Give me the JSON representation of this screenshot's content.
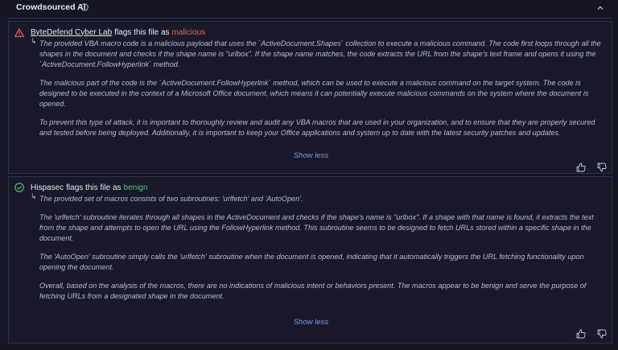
{
  "header": {
    "title": "Crowdsourced AI",
    "info_icon": "info-icon",
    "collapse_icon": "chevron-up-icon"
  },
  "colors": {
    "malicious": "#f2645e",
    "benign": "#57c27a",
    "link": "#7b9cf0",
    "background": "#151524"
  },
  "results": [
    {
      "status_icon": "warning-triangle-icon",
      "vendor": "ByteDefend Cyber Lab",
      "flag_text": "flags this file as",
      "verdict": "malicious",
      "paragraphs": [
        "The provided VBA macro code is a malicious payload that uses the `ActiveDocument.Shapes` collection to execute a malicious command. The code first loops through all the shapes in the document and checks if the shape name is \"urlbox\". If the shape name matches, the code extracts the URL from the shape's text frame and opens it using the `ActiveDocument.FollowHyperlink` method.",
        "The malicious part of the code is the `ActiveDocument.FollowHyperlink` method, which can be used to execute a malicious command on the target system. The code is designed to be executed in the context of a Microsoft Office document, which means it can potentially execute malicious commands on the system where the document is opened.",
        "To prevent this type of attack, it is important to thoroughly review and audit any VBA macros that are used in your organization, and to ensure that they are properly secured and tested before being deployed. Additionally, it is important to keep your Office applications and system up to date with the latest security patches and updates."
      ],
      "show_less": "Show less"
    },
    {
      "status_icon": "check-circle-icon",
      "vendor": "Hispasec",
      "flag_text": "flags this file as",
      "verdict": "benign",
      "paragraphs": [
        "The provided set of macros consists of two subroutines: 'urlfetch' and 'AutoOpen'.",
        "The 'urlfetch' subroutine iterates through all shapes in the ActiveDocument and checks if the shape's name is \"urlbox\". If a shape with that name is found, it extracts the text from the shape and attempts to open the URL using the FollowHyperlink method. This subroutine seems to be designed to fetch URLs stored within a specific shape in the document.",
        "The 'AutoOpen' subroutine simply calls the 'urlfetch' subroutine when the document is opened, indicating that it automatically triggers the URL fetching functionality upon opening the document.",
        "Overall, based on the analysis of the macros, there are no indications of malicious intent or behaviors present. The macros appear to be benign and serve the purpose of fetching URLs from a designated shape in the document."
      ],
      "show_less": "Show less"
    }
  ]
}
